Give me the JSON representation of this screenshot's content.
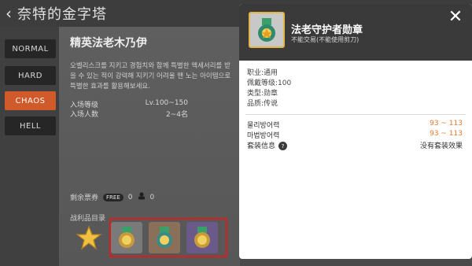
{
  "header": {
    "back_icon": "chevron-left-icon",
    "title": "奈特的金字塔"
  },
  "difficulty": {
    "buttons": [
      "NORMAL",
      "HARD",
      "CHAOS",
      "HELL"
    ],
    "active": "CHAOS",
    "active_color": "#d05a2a"
  },
  "boss": {
    "name": "精英法老木乃伊",
    "description": "오벨리스크를 지키고 경험치와 함께 특별한 액세서리를 받을 수 있는 적이 강력해 지키기 어려울 땐 노는 아이템으로 특별한 효과를 활용해보세요.",
    "level_label": "入场等级",
    "level_value": "Lv.100~150",
    "players_label": "入场人数",
    "players_value": "2~4名",
    "remaining_label": "剩余票券",
    "free_badge": "FREE",
    "free_count": "0",
    "ticket_count": "0",
    "loot_label": "战利品目录"
  },
  "loot_items": [
    {
      "icon": "star-item-icon",
      "style": "star"
    },
    {
      "icon": "medal-icon",
      "style": "normal"
    },
    {
      "icon": "medal-icon",
      "style": "brown"
    },
    {
      "icon": "medal-icon",
      "style": "purple"
    }
  ],
  "highlight_color": "#d81e1e",
  "tooltip": {
    "item_name": "法老守护者勋章",
    "item_sub": "不能交易(不能使用剪刀)",
    "close_icon": "close-icon",
    "job": "职业:通用",
    "req_level": "佩戴等级:100",
    "type": "类型:勋章",
    "quality": "品质:传说",
    "stats": [
      {
        "label": "물리방어력",
        "value": "93 ~ 113"
      },
      {
        "label": "마법방어력",
        "value": "93 ~ 113"
      }
    ],
    "set_label": "套装信息",
    "set_value": "没有套装效果",
    "stat_color": "#e5772e"
  }
}
